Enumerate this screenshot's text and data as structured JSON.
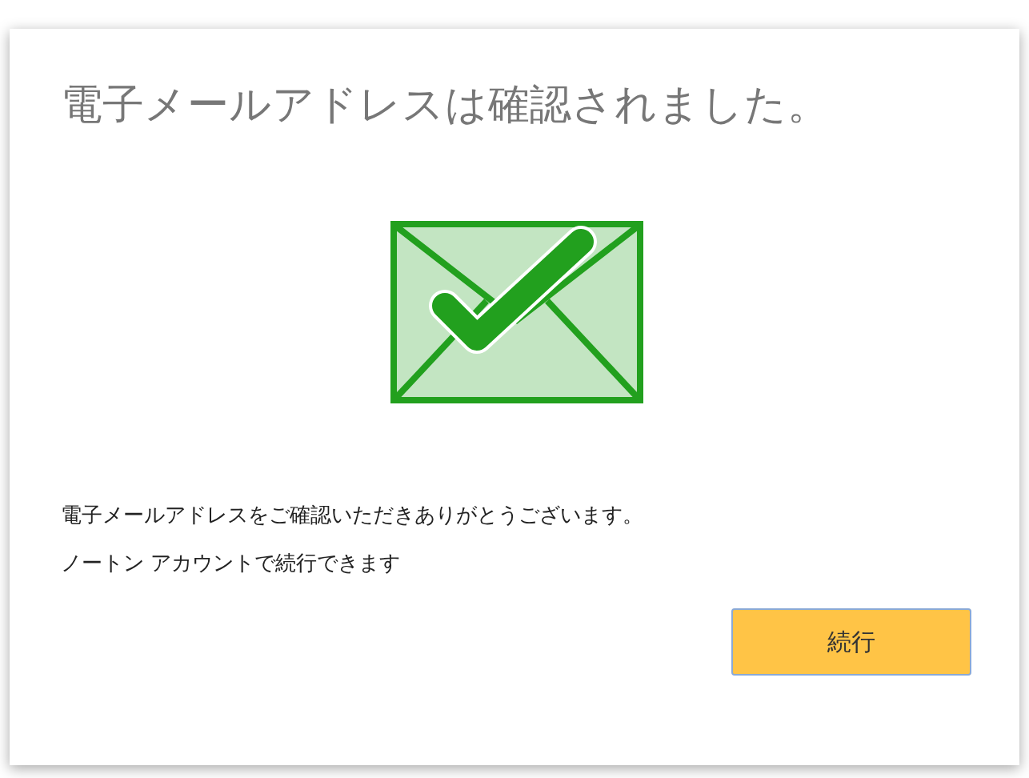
{
  "dialog": {
    "title": "電子メールアドレスは確認されました。",
    "messages": [
      "電子メールアドレスをご確認いただきありがとうございます。",
      "ノートン アカウントで続行できます"
    ],
    "buttons": [
      "続行"
    ]
  }
}
